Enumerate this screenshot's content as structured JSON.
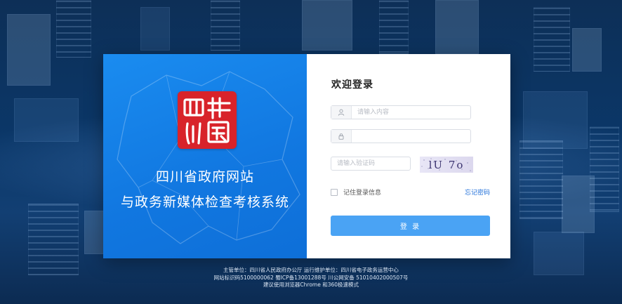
{
  "site": {
    "title_line1": "四川省政府网站",
    "title_line2": "与政务新媒体检查考核系统",
    "seal_text": "四川中國"
  },
  "login": {
    "heading": "欢迎登录",
    "username_placeholder": "请输入内容",
    "password_value": "",
    "captcha_placeholder": "请输入验证码",
    "captcha_text": "lU 7o",
    "remember_label": "记住登录信息",
    "forgot_label": "忘记密码",
    "submit_label": "登 录"
  },
  "footer": {
    "line1": "主管单位：四川省人民政府办公厅     运行维护单位：四川省电子政务运营中心",
    "line2": "网站标识码5100000062    蜀ICP备13001288号    川公网安备 51010402000507号",
    "line3": "建议使用浏览器Chrome 和360极速模式"
  },
  "colors": {
    "left_panel": "#1177e0",
    "seal_red": "#d8232a",
    "button": "#4aa3f4",
    "link": "#1f6fd9"
  },
  "icons": {
    "user": "user-icon",
    "lock": "lock-icon"
  }
}
